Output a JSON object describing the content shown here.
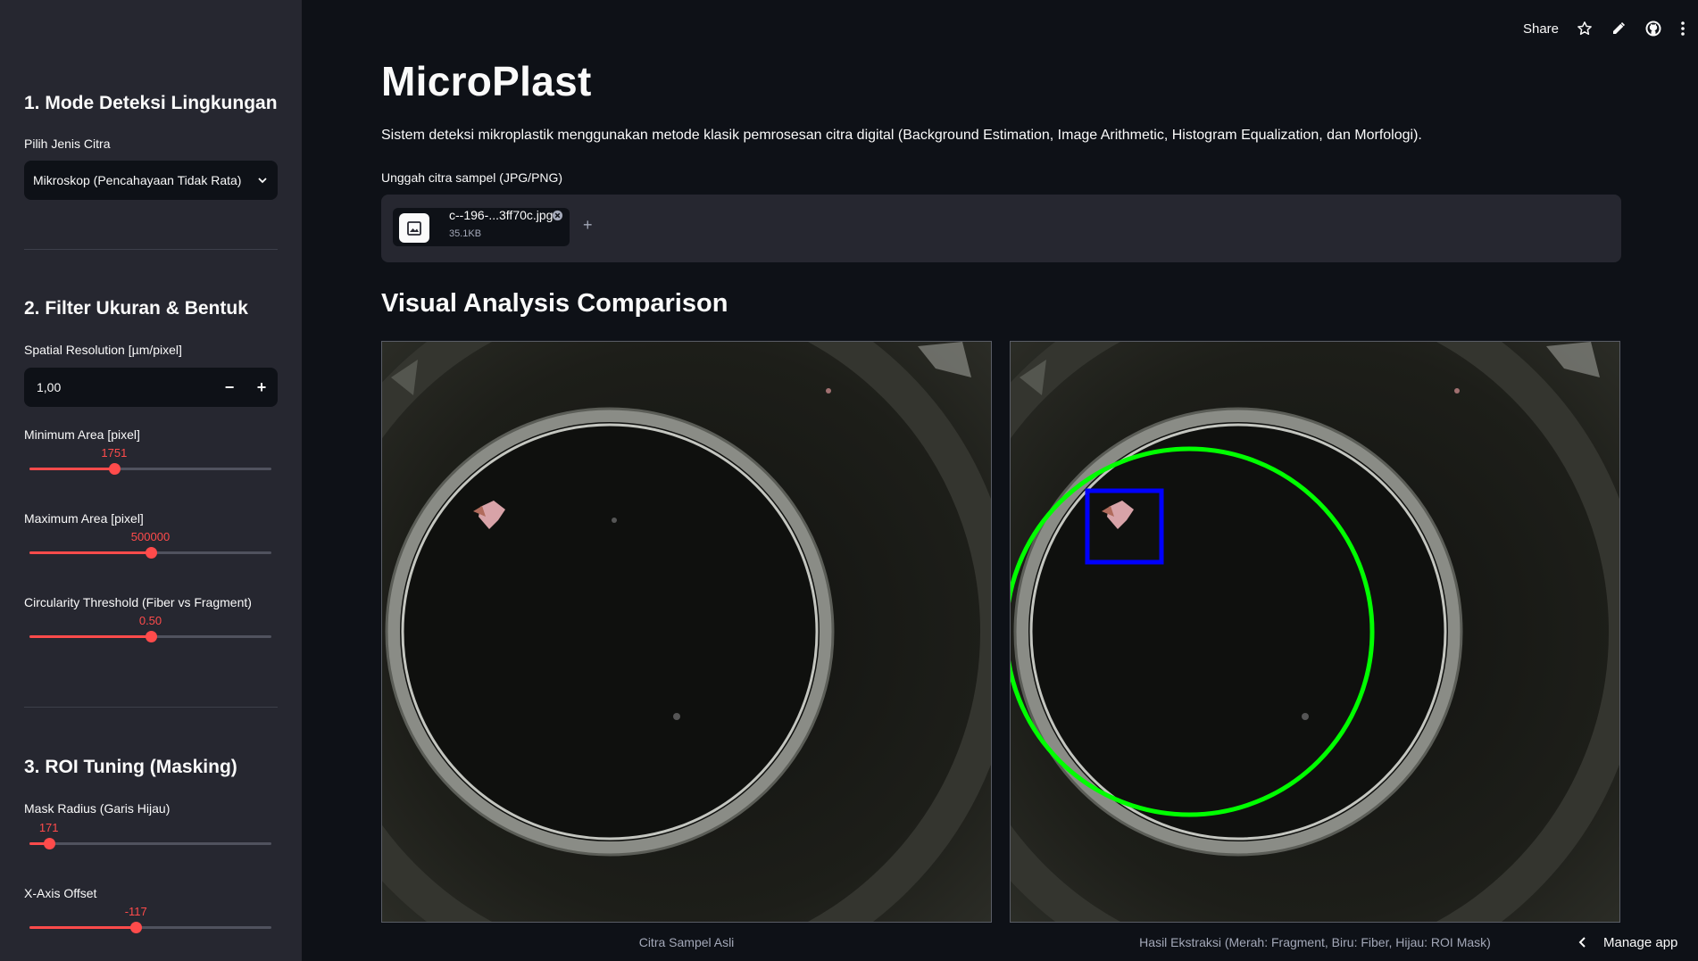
{
  "toolbar": {
    "share_label": "Share"
  },
  "sidebar": {
    "section1": {
      "heading": "1. Mode Deteksi Lingkungan",
      "select_label": "Pilih Jenis Citra",
      "select_value": "Mikroskop (Pencahayaan Tidak Rata)"
    },
    "section2": {
      "heading": "2. Filter Ukuran & Bentuk",
      "resolution_label": "Spatial Resolution [µm/pixel]",
      "resolution_value": "1,00",
      "min_area": {
        "label": "Minimum Area [pixel]",
        "value": "1751",
        "fraction": 0.35
      },
      "max_area": {
        "label": "Maximum Area [pixel]",
        "value": "500000",
        "fraction": 0.5
      },
      "circularity": {
        "label": "Circularity Threshold (Fiber vs Fragment)",
        "value": "0.50",
        "fraction": 0.5
      }
    },
    "section3": {
      "heading": "3. ROI Tuning (Masking)",
      "mask_radius": {
        "label": "Mask Radius (Garis Hijau)",
        "value": "171",
        "fraction": 0.08
      },
      "x_offset": {
        "label": "X-Axis Offset",
        "value": "-117",
        "fraction": 0.44
      }
    }
  },
  "main": {
    "title": "MicroPlast",
    "description": "Sistem deteksi mikroplastik menggunakan metode klasik pemrosesan citra digital (Background Estimation, Image Arithmetic, Histogram Equalization, dan Morfologi).",
    "upload_label": "Unggah citra sampel (JPG/PNG)",
    "file": {
      "name": "c--196-...3ff70c.jpg",
      "size": "35.1KB"
    },
    "subheader": "Visual Analysis Comparison",
    "caption_left": "Citra Sampel Asli",
    "caption_right": "Hasil Ekstraksi (Merah: Fragment, Biru: Fiber, Hijau: ROI Mask)"
  },
  "footer": {
    "manage_label": "Manage app"
  },
  "colors": {
    "accent": "#ff4b4b",
    "roi": "#00ff00",
    "fiber_box": "#0000ff"
  }
}
